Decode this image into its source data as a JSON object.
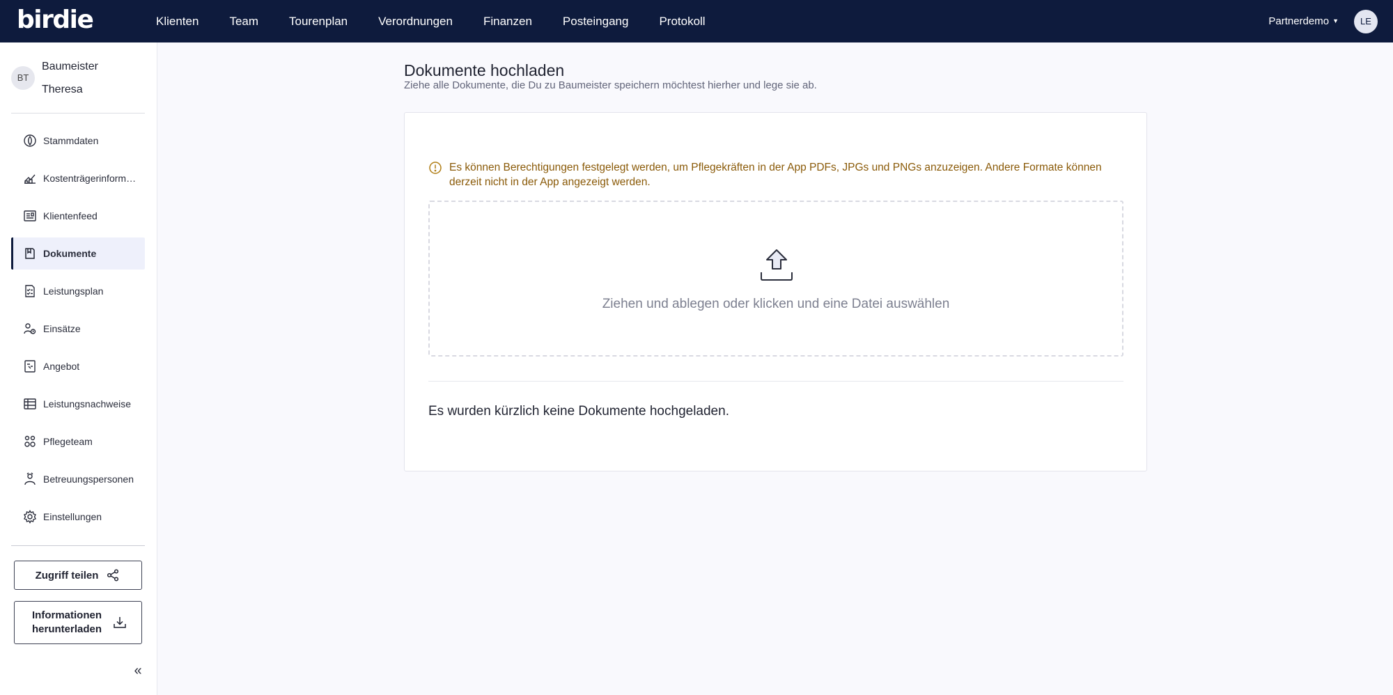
{
  "brand": {
    "logo": "birdie"
  },
  "nav": {
    "items": [
      "Klienten",
      "Team",
      "Tourenplan",
      "Verordnungen",
      "Finanzen",
      "Posteingang",
      "Protokoll"
    ],
    "partner": "Partnerdemo",
    "user_initials": "LE"
  },
  "sidebar": {
    "client": {
      "initials": "BT",
      "name": "Baumeister Theresa"
    },
    "items": [
      {
        "label": "Stammdaten",
        "icon": "master-data-icon"
      },
      {
        "label": "Kostenträgerinformationen",
        "icon": "cost-bearer-icon"
      },
      {
        "label": "Klientenfeed",
        "icon": "feed-icon"
      },
      {
        "label": "Dokumente",
        "icon": "documents-icon",
        "active": true
      },
      {
        "label": "Leistungsplan",
        "icon": "service-plan-icon"
      },
      {
        "label": "Einsätze",
        "icon": "assignments-icon"
      },
      {
        "label": "Angebot",
        "icon": "offer-icon"
      },
      {
        "label": "Leistungsnachweise",
        "icon": "table-icon"
      },
      {
        "label": "Pflegeteam",
        "icon": "care-team-icon"
      },
      {
        "label": "Betreuungspersonen",
        "icon": "caregivers-icon"
      },
      {
        "label": "Einstellungen",
        "icon": "gear-icon"
      }
    ],
    "share_button": "Zugriff teilen",
    "download_button": "Informationen herunterladen"
  },
  "main": {
    "title": "Dokumente hochladen",
    "subtitle": "Ziehe alle Dokumente, die Du zu Baumeister speichern möchtest hierher und lege sie ab.",
    "warning": "Es können Berechtigungen festgelegt werden, um Pflegekräften in der App PDFs, JPGs und PNGs anzuzeigen. Andere Formate können derzeit nicht in der App angezeigt werden.",
    "dropzone_text": "Ziehen und ablegen oder klicken und eine Datei auswählen",
    "empty_text": "Es wurden kürzlich keine Dokumente hochgeladen."
  },
  "colors": {
    "topbar": "#0e1b3d",
    "warning_text": "#8a5a08",
    "active_bg": "#eef0fb"
  }
}
